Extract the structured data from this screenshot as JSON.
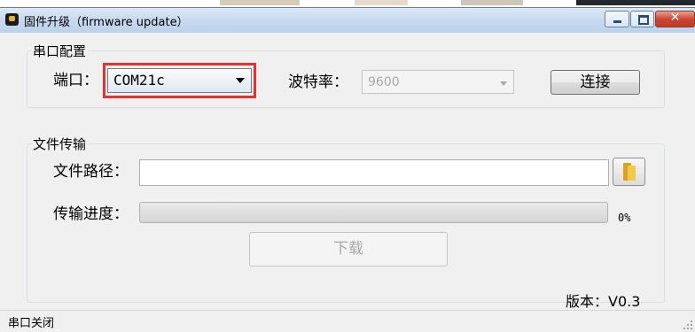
{
  "window": {
    "title": "固件升级（firmware update）",
    "close_glyph": "✕"
  },
  "serial_config": {
    "group_label": "串口配置",
    "port_label": "端口：",
    "port_value": "COM21c",
    "baud_label": "波特率：",
    "baud_value": "9600",
    "connect_label": "连接"
  },
  "file_transfer": {
    "group_label": "文件传输",
    "path_label": "文件路径：",
    "path_value": "",
    "progress_label": "传输进度：",
    "progress_fraction": 0,
    "progress_text": "0%",
    "download_label": "下载"
  },
  "footer": {
    "version": "版本：V0.3"
  },
  "statusbar": {
    "text": "串口关闭"
  },
  "colors": {
    "highlight": "#e8312f",
    "titlebar": "#c6d8ee",
    "progress_fill": "#37b44a"
  },
  "icons": {
    "app": "app-icon",
    "browse": "folder-icon",
    "dropdown": "chevron-down-icon"
  }
}
